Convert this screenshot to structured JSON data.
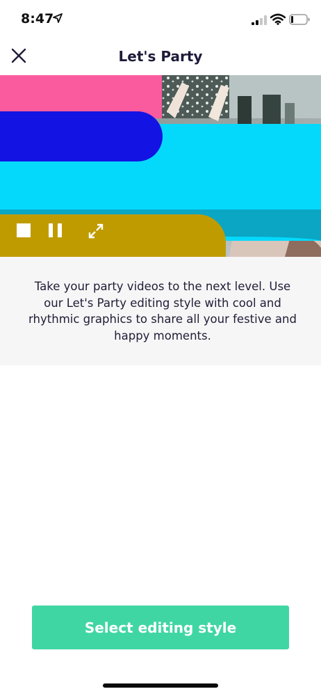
{
  "status_bar": {
    "time": "8:47",
    "icons": [
      "location-arrow-icon",
      "signal-icon",
      "wifi-icon",
      "battery-icon"
    ]
  },
  "nav": {
    "title": "Let's Party",
    "close_icon": "close-icon"
  },
  "video": {
    "controls": [
      "stop-icon",
      "pause-icon",
      "fullscreen-icon"
    ],
    "graphic_colors": {
      "pink": "#fa5b9e",
      "blue": "#1313e4",
      "cyan": "#05d9fb",
      "teal": "#0aa6c4",
      "mustard": "#bf9b00"
    }
  },
  "description": {
    "text": "Take your party videos to the next level. Use our Let's Party editing style with cool and rhythmic graphics to share all your festive and happy moments."
  },
  "cta": {
    "label": "Select editing style",
    "color": "#40d6a3"
  }
}
